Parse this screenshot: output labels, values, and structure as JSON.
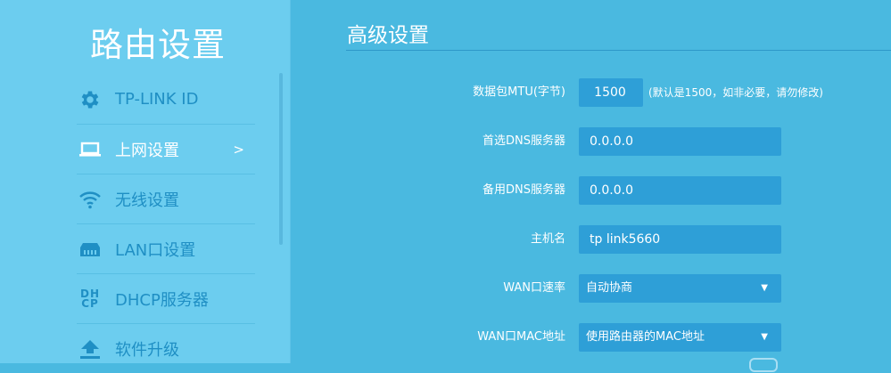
{
  "sidebar": {
    "title": "路由设置",
    "items": [
      {
        "label": "TP-LINK ID",
        "icon": "gear-icon",
        "active": false
      },
      {
        "label": "上网设置",
        "icon": "laptop-icon",
        "active": true,
        "arrow": ">"
      },
      {
        "label": "无线设置",
        "icon": "wifi-icon",
        "active": false
      },
      {
        "label": "LAN口设置",
        "icon": "lan-port-icon",
        "active": false
      },
      {
        "label": "DHCP服务器",
        "icon": "dhcp-icon",
        "icon_text_top": "DH",
        "icon_text_bottom": "CP",
        "active": false
      },
      {
        "label": "软件升级",
        "icon": "upload-icon",
        "active": false
      }
    ]
  },
  "main": {
    "title": "高级设置",
    "fields": {
      "mtu": {
        "label": "数据包MTU(字节)",
        "value": "1500",
        "hint": "(默认是1500，如非必要，请勿修改)"
      },
      "primary_dns": {
        "label": "首选DNS服务器",
        "value": "0.0.0.0"
      },
      "secondary_dns": {
        "label": "备用DNS服务器",
        "value": "0.0.0.0"
      },
      "hostname": {
        "label": "主机名",
        "value": "tp link5660"
      },
      "wan_speed": {
        "label": "WAN口速率",
        "value": "自动协商"
      },
      "wan_mac": {
        "label": "WAN口MAC地址",
        "value": "使用路由器的MAC地址"
      }
    }
  },
  "colors": {
    "background": "#4ab9e0",
    "sidebar": "#6ccdef",
    "field": "#2e9fd7",
    "nav_text": "#1f8fc4",
    "text": "#ffffff"
  }
}
